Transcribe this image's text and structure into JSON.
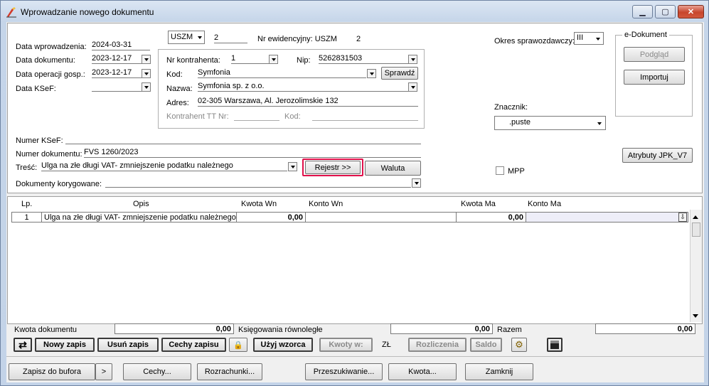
{
  "window": {
    "title": "Wprowadzanie nowego dokumentu",
    "min": "▁",
    "max": "▢",
    "close": "✕"
  },
  "header": {
    "data_wprowadzenia_label": "Data wprowadzenia:",
    "data_wprowadzenia": "2024-03-31",
    "data_dokumentu_label": "Data dokumentu:",
    "data_dokumentu": "2023-12-17",
    "data_operacji_label": "Data operacji gosp.:",
    "data_operacji": "2023-12-17",
    "data_ksef_label": "Data KSeF:",
    "data_ksef": "",
    "rejestr_code": "USZM",
    "rejestr_num": "2",
    "nr_ewidencyjny_label": "Nr ewidencyjny: USZM",
    "nr_ewidencyjny": "2",
    "okres_label": "Okres sprawozdawczy:",
    "okres": "III"
  },
  "contractor": {
    "nr_label": "Nr kontrahenta:",
    "nr": "1",
    "nip_label": "Nip:",
    "nip": "5262831503",
    "kod_label": "Kod:",
    "kod": "Symfonia",
    "sprawdz": "Sprawdź",
    "nazwa_label": "Nazwa:",
    "nazwa": "Symfonia sp. z o.o.",
    "adres_label": "Adres:",
    "adres": "02-305 Warszawa, Al. Jerozolimskie 132",
    "tt_label": "Kontrahent TT Nr:",
    "tt_kod_label": "Kod:"
  },
  "edoc": {
    "title": "e-Dokument",
    "podglad": "Podgląd",
    "importuj": "Importuj"
  },
  "znacznik": {
    "label": "Znacznik:",
    "value": ".puste"
  },
  "atrybuty": "Atrybuty JPK_V7",
  "mpp": "MPP",
  "doc": {
    "numer_ksef_label": "Numer KSeF:",
    "numer_ksef": "",
    "numer_dok_label": "Numer dokumentu:",
    "numer_dok": "FVS 1260/2023",
    "tresc_label": "Treść:",
    "tresc": "Ulga na złe długi VAT- zmniejszenie podatku należnego",
    "rejestr_btn": "Rejestr >>",
    "waluta_btn": "Waluta",
    "korygowane_label": "Dokumenty korygowane:"
  },
  "grid": {
    "headers": {
      "lp": "Lp.",
      "opis": "Opis",
      "kwota_wn": "Kwota  Wn",
      "konto_wn": "Konto  Wn",
      "kwota_ma": "Kwota Ma",
      "konto_ma": "Konto Ma"
    },
    "rows": [
      {
        "lp": "1",
        "opis": "Ulga na złe długi VAT- zmniejszenie podatku należnego",
        "kwota_wn": "0,00",
        "konto_wn": "",
        "kwota_ma": "0,00",
        "konto_ma": ""
      }
    ]
  },
  "summary": {
    "kwota_dok_label": "Kwota dokumentu",
    "kwota_dok": "0,00",
    "ksieg_label": "Księgowania równoległe",
    "ksieg": "0,00",
    "razem_label": "Razem",
    "razem": "0,00"
  },
  "toolbar": {
    "nowy": "Nowy zapis",
    "usun": "Usuń zapis",
    "cechy": "Cechy zapisu",
    "uzyj": "Użyj wzorca",
    "kwoty": "Kwoty w:",
    "zl": "ZŁ",
    "rozliczenia": "Rozliczenia",
    "saldo": "Saldo"
  },
  "bottom": {
    "zapisz": "Zapisz do bufora",
    "more": ">",
    "cechy": "Cechy...",
    "rozrachunki": "Rozrachunki...",
    "przeszukiwanie": "Przeszukiwanie...",
    "kwota": "Kwota...",
    "zamknij": "Zamknij"
  }
}
